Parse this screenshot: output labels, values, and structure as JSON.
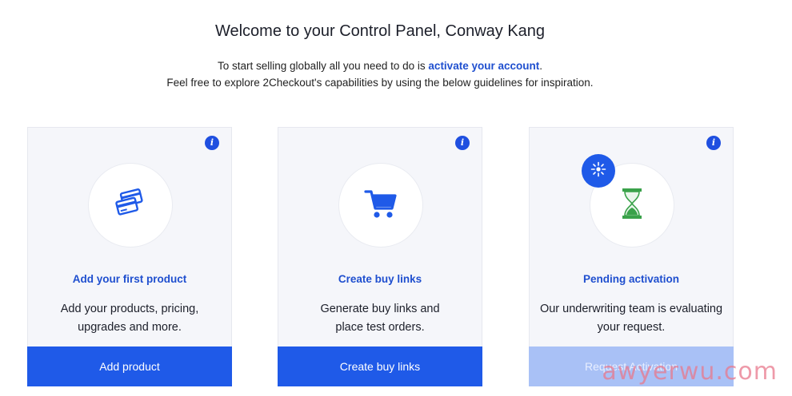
{
  "header": {
    "title": "Welcome to your Control Panel, Conway Kang",
    "intro_prefix": "To start selling globally all you need to do is ",
    "intro_link": "activate your account",
    "intro_suffix": ".",
    "intro_line2": "Feel free to explore 2Checkout's capabilities by using the below guidelines for inspiration."
  },
  "cards": [
    {
      "title": "Add your first product",
      "desc_line1": "Add your products, pricing,",
      "desc_line2": "upgrades and more.",
      "button": "Add product",
      "icon": "credit-cards-icon",
      "info": "i"
    },
    {
      "title": "Create buy links",
      "desc_line1": "Generate buy links and",
      "desc_line2": "place test orders.",
      "button": "Create buy links",
      "icon": "shopping-cart-icon",
      "info": "i"
    },
    {
      "title": "Pending activation",
      "desc_line1": "Our underwriting team is evaluating",
      "desc_line2": "your request.",
      "button": "Request Activation",
      "icon": "hourglass-icon",
      "badge_icon": "sparkle-icon",
      "info": "i",
      "button_disabled": true
    }
  ],
  "watermark": "awyerwu.com",
  "colors": {
    "accent": "#1f5ae8",
    "link": "#1f4fcf",
    "disabled": "#a9c1f6",
    "hourglass": "#3aa24a"
  }
}
